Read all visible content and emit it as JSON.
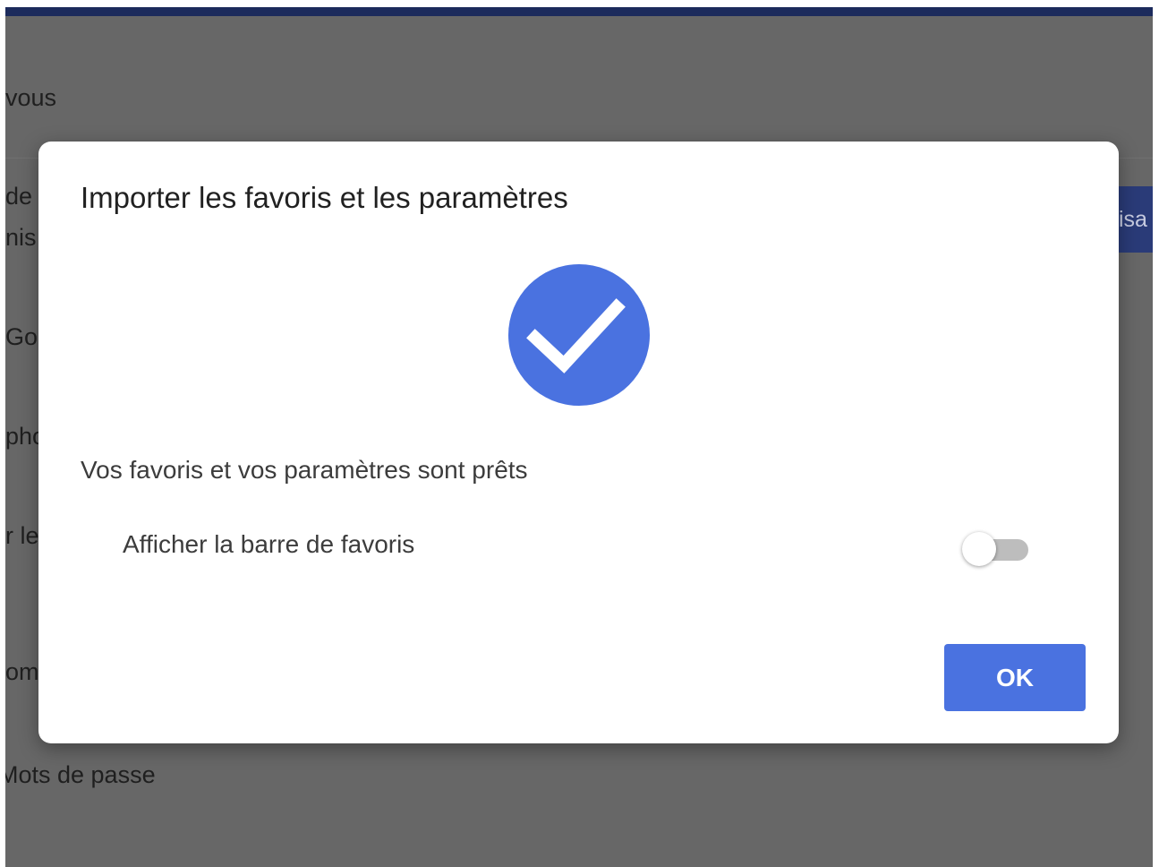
{
  "background": {
    "rows": [
      "vous",
      "de",
      "nis",
      "Go",
      "pho",
      "r le",
      "om",
      "Mots de passe"
    ],
    "accent_button_label": "isa"
  },
  "dialog": {
    "title": "Importer les favoris et les paramètres",
    "icon": "check-circle-icon",
    "status_text": "Vos favoris et vos paramètres sont prêts",
    "setting": {
      "label": "Afficher la barre de favoris",
      "enabled": false
    },
    "ok_label": "OK"
  },
  "colors": {
    "accent": "#4a72e0",
    "overlay": "#676767",
    "topbar": "#1c2b5c"
  }
}
